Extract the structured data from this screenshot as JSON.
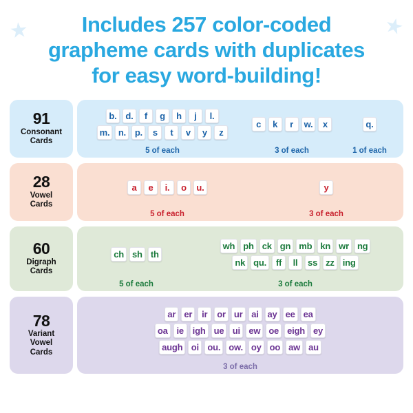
{
  "header": {
    "title": "Includes 257 color-coded\ngrapheme cards with duplicates\nfor easy word-building!",
    "title_color": "#29a8e0",
    "star_glyph": "★"
  },
  "rows": [
    {
      "key": "consonant",
      "count": "91",
      "name": "Consonant\nCards",
      "bg": "#d6ecfa",
      "ink": "#1c63a8",
      "groups": [
        {
          "note": "5 of each",
          "lines": [
            [
              "b.",
              "d.",
              "f",
              "g",
              "h",
              "j",
              "l."
            ],
            [
              "m.",
              "n.",
              "p.",
              "s",
              "t",
              "v",
              "y",
              "z"
            ]
          ]
        },
        {
          "note": "3 of each",
          "lines": [
            [
              "c",
              "k",
              "r",
              "w.",
              "x"
            ]
          ]
        },
        {
          "note": "1 of each",
          "lines": [
            [
              "q."
            ]
          ]
        }
      ]
    },
    {
      "key": "vowel",
      "count": "28",
      "name": "Vowel\nCards",
      "bg": "#fadfd2",
      "ink": "#c8202d",
      "groups": [
        {
          "note": "5 of each",
          "lines": [
            [
              "a",
              "e",
              "i.",
              "o",
              "u."
            ]
          ]
        },
        {
          "note": "3 of each",
          "lines": [
            [
              "y"
            ]
          ]
        }
      ]
    },
    {
      "key": "digraph",
      "count": "60",
      "name": "Digraph\nCards",
      "bg": "#dfe9d8",
      "ink": "#1b7a3c",
      "groups": [
        {
          "note": "5 of each",
          "lines": [
            [
              "ch",
              "sh",
              "th"
            ]
          ]
        },
        {
          "note": "3 of each",
          "lines": [
            [
              "wh",
              "ph",
              "ck",
              "gn",
              "mb",
              "kn",
              "wr",
              "ng"
            ],
            [
              "nk",
              "qu.",
              "ff",
              "ll",
              "ss",
              "zz",
              "ing"
            ]
          ]
        }
      ]
    },
    {
      "key": "variant",
      "count": "78",
      "name": "Variant\nVowel\nCards",
      "bg": "#ddd8ec",
      "ink": "#6b3493",
      "groups": [
        {
          "note": "3 of each",
          "lines": [
            [
              "ar",
              "er",
              "ir",
              "or",
              "ur",
              "ai",
              "ay",
              "ee",
              "ea"
            ],
            [
              "oa",
              "ie",
              "igh",
              "ue",
              "ui",
              "ew",
              "oe",
              "eigh",
              "ey"
            ],
            [
              "augh",
              "oi",
              "ou.",
              "ow.",
              "oy",
              "oo",
              "aw",
              "au"
            ]
          ]
        }
      ]
    }
  ]
}
